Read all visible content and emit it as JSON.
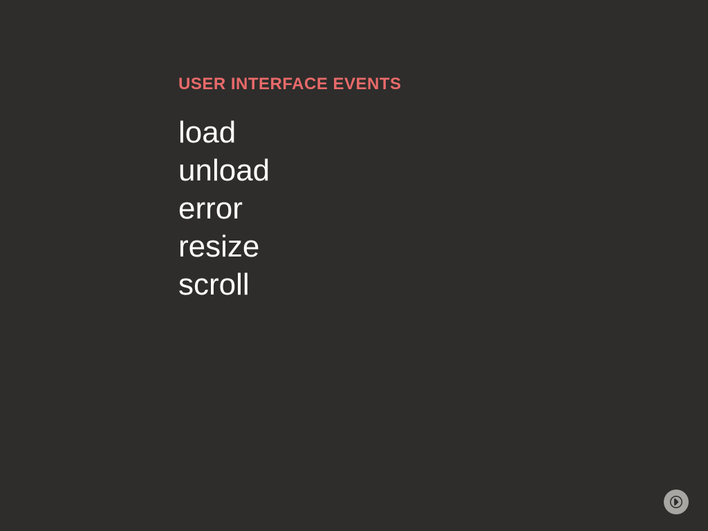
{
  "slide": {
    "heading": "USER INTERFACE EVENTS",
    "events": {
      "item0": "load",
      "item1": "unload",
      "item2": "error",
      "item3": "resize",
      "item4": "scroll"
    }
  },
  "colors": {
    "background": "#2e2d2b",
    "heading": "#e96a6a",
    "text": "#ffffff",
    "button": "#a7a6a3"
  }
}
